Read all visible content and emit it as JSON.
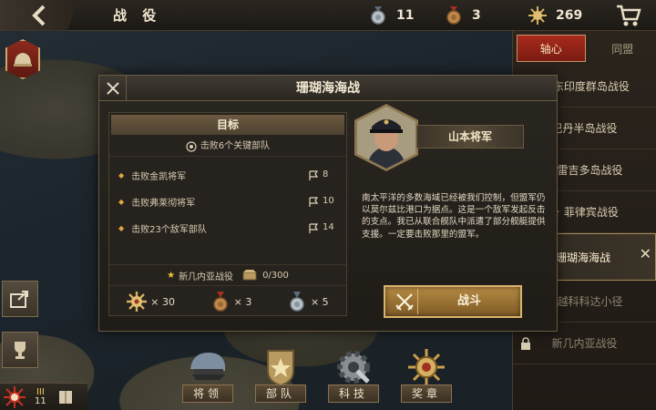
{
  "header": {
    "title": "战 役",
    "resources": [
      {
        "icon": "silver-medal-icon",
        "value": "11"
      },
      {
        "icon": "bronze-medal-icon",
        "value": "3"
      },
      {
        "icon": "gold-star-medal-icon",
        "value": "269"
      }
    ]
  },
  "right_panel": {
    "tabs": [
      {
        "label": "轴心",
        "active": true
      },
      {
        "label": "同盟",
        "active": false
      }
    ],
    "campaigns": [
      {
        "label": "东印度群岛战役",
        "star": true,
        "locked": false,
        "selected": false
      },
      {
        "label": "巴丹半岛战役",
        "star": false,
        "locked": false,
        "selected": false
      },
      {
        "label": "科雷吉多岛战役",
        "star": false,
        "locked": false,
        "selected": false
      },
      {
        "label": "菲律宾战役",
        "star": true,
        "locked": false,
        "selected": false
      },
      {
        "label": "珊瑚海海战",
        "star": false,
        "locked": false,
        "selected": true
      },
      {
        "label": "穿越科科达小径",
        "star": false,
        "locked": true,
        "selected": false
      },
      {
        "label": "新几内亚战役",
        "star": false,
        "locked": true,
        "selected": false
      }
    ]
  },
  "bottom_nav": [
    {
      "label": "将领",
      "icon": "general-cap-icon"
    },
    {
      "label": "部队",
      "icon": "troops-badge-icon"
    },
    {
      "label": "科技",
      "icon": "tech-gear-icon"
    },
    {
      "label": "奖章",
      "icon": "medal-icon"
    }
  ],
  "rank": {
    "chevron": "III",
    "level": "11"
  },
  "modal": {
    "title": "珊瑚海海战",
    "objectives": {
      "header": "目标",
      "subtitle": "击败6个关键部队",
      "goals": [
        {
          "label": "击败金凯将军",
          "value": "8"
        },
        {
          "label": "击败弗莱彻将军",
          "value": "10"
        },
        {
          "label": "击败23个敌军部队",
          "value": "14"
        }
      ]
    },
    "campaign_progress": {
      "label": "新几内亚战役",
      "value": "0/300"
    },
    "rewards": [
      {
        "icon": "gold-star-medal-icon",
        "value": "× 30"
      },
      {
        "icon": "bronze-medal-icon",
        "value": "× 3"
      },
      {
        "icon": "silver-medal-icon",
        "value": "× 5"
      }
    ],
    "general_name": "山本将军",
    "story": "南太平洋的多数海域已经被我们控制，但盟军仍以莫尔兹比港口为据点。这是一个敌军发起反击的支点。我已从联合舰队中派遣了部分舰艇提供支援。一定要击败那里的盟军。",
    "battle_button": "战斗"
  },
  "colors": {
    "accent_red": "#a82a1c",
    "gold": "#d8b46c",
    "star": "#f0c23a"
  }
}
